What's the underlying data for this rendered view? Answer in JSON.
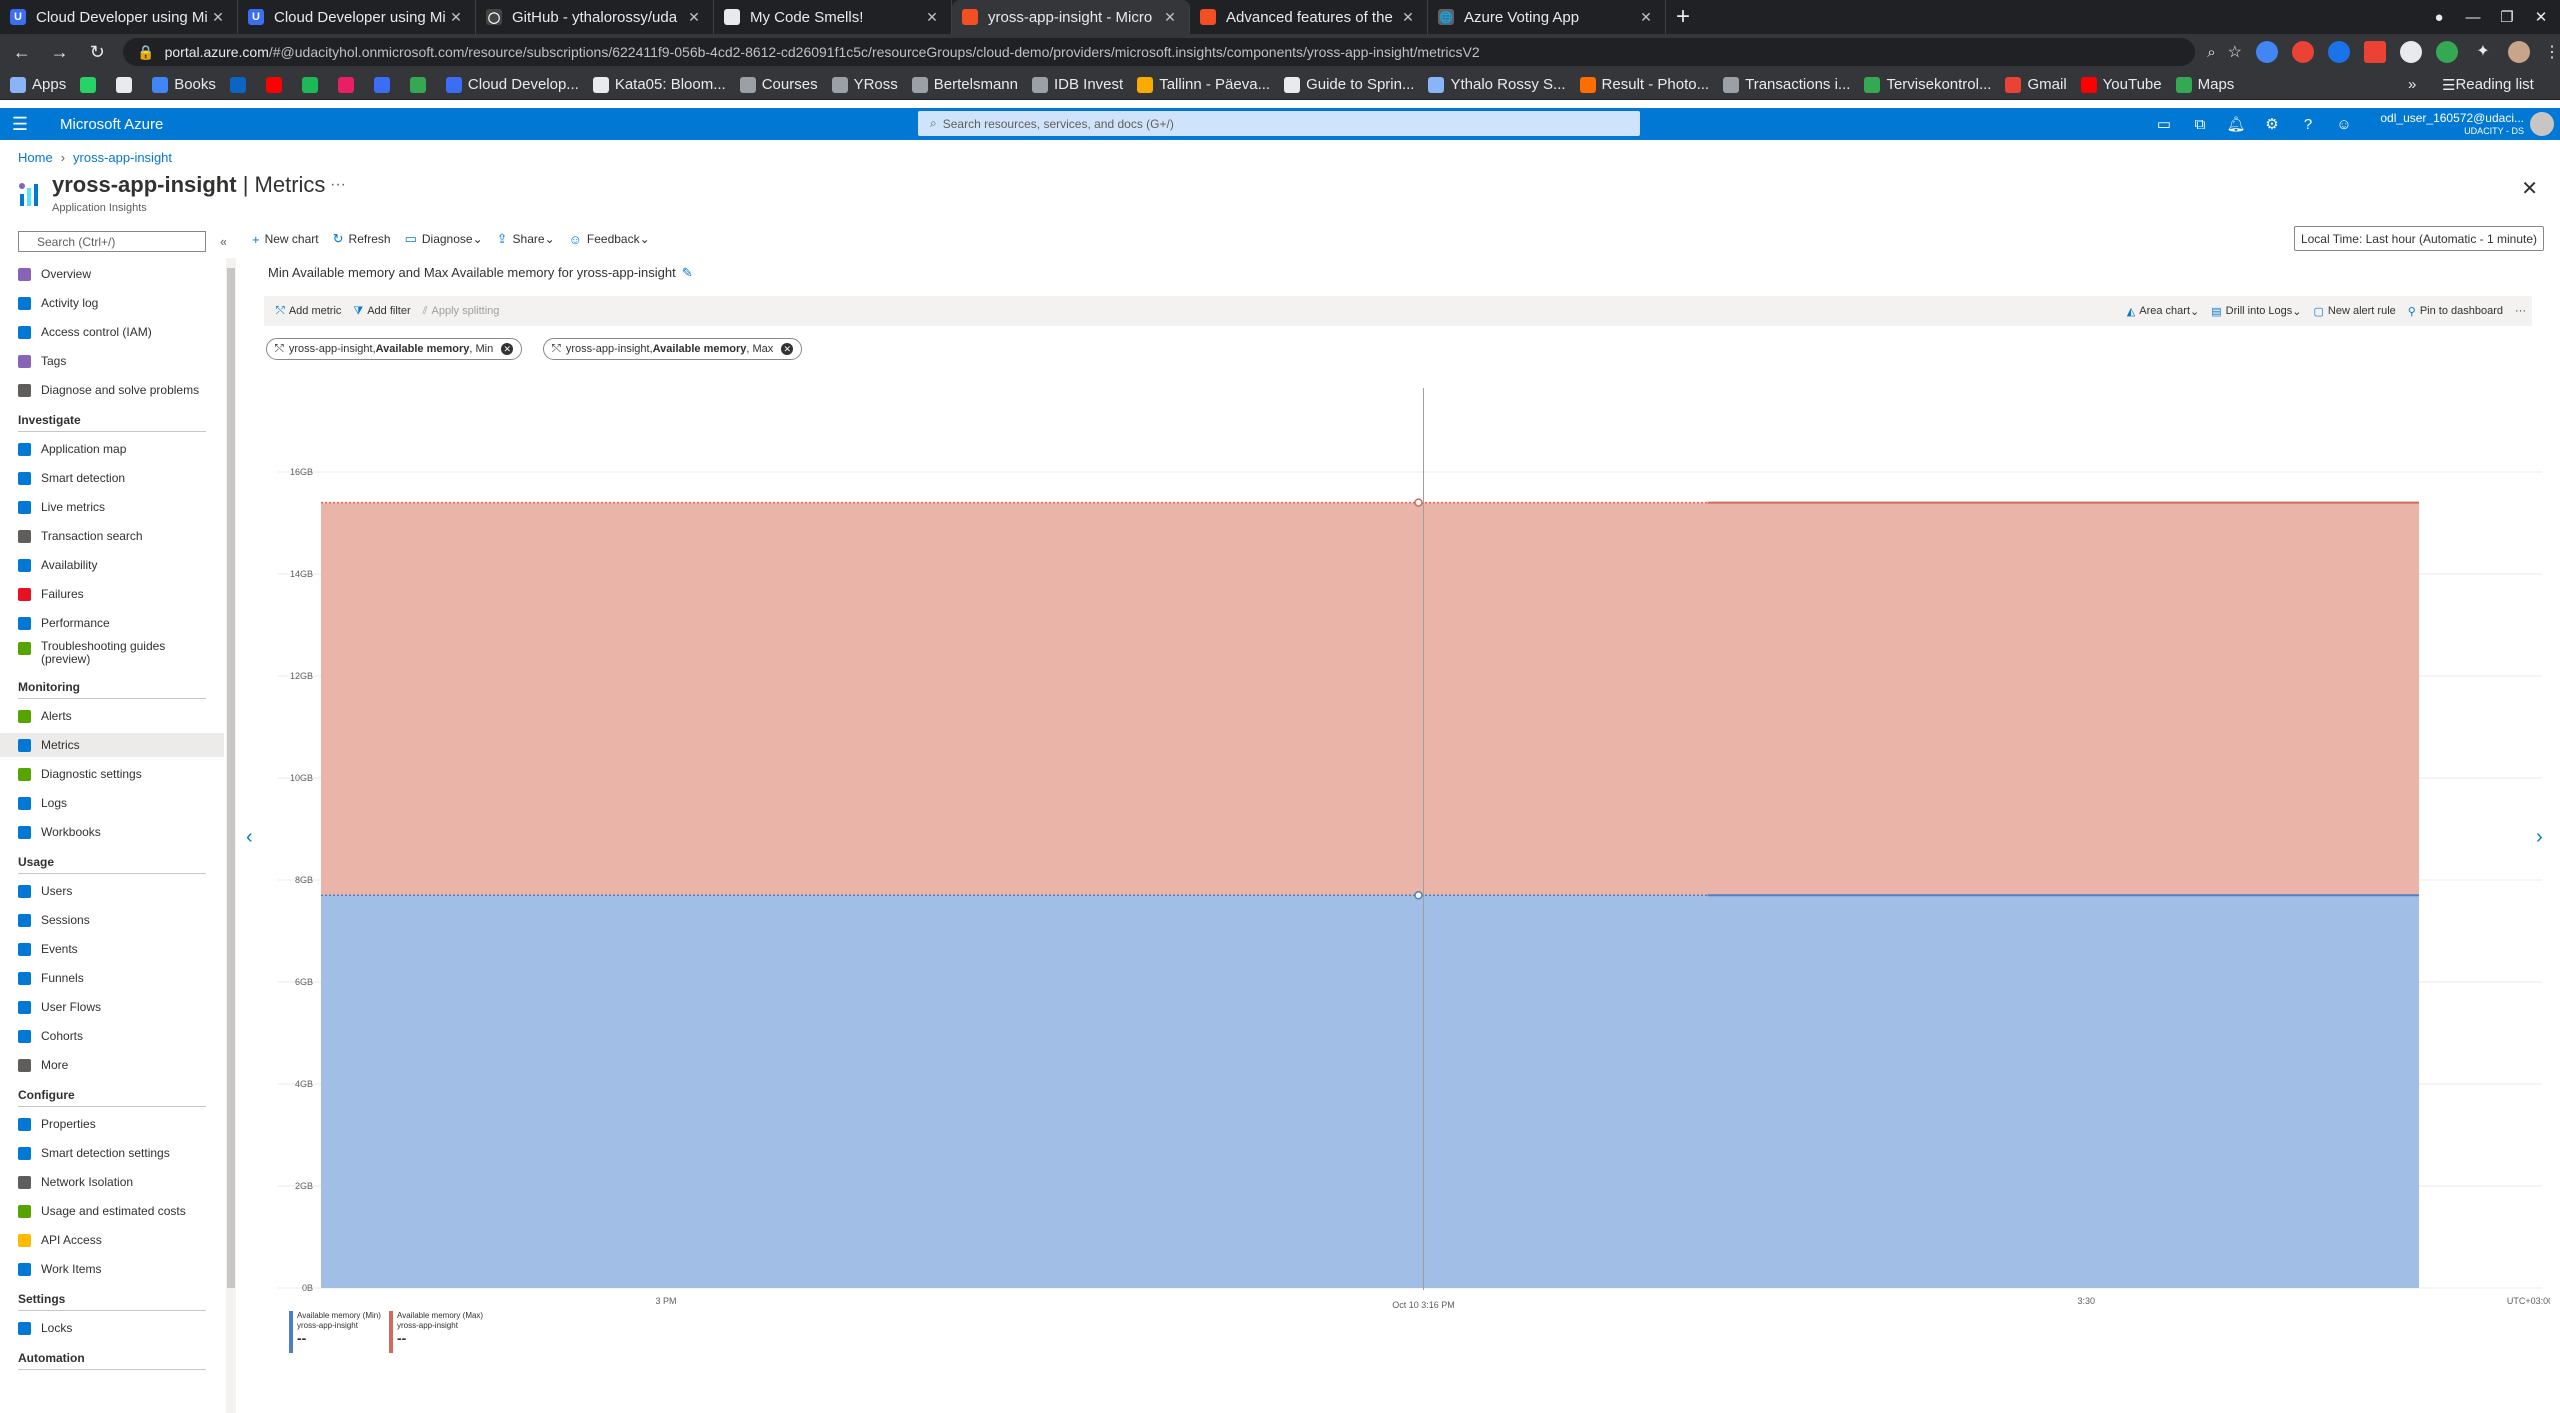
{
  "browser": {
    "tabs": [
      {
        "label": "Cloud Developer using Mi",
        "color": "#3b6ef5",
        "glyph": "U",
        "active": false
      },
      {
        "label": "Cloud Developer using Mi",
        "color": "#3b6ef5",
        "glyph": "U",
        "active": false
      },
      {
        "label": "GitHub - ythalorossy/uda",
        "color": "#444444",
        "glyph": "◯",
        "active": false
      },
      {
        "label": "My Code Smells!",
        "color": "#e8eaed",
        "glyph": "",
        "active": false
      },
      {
        "label": "yross-app-insight - Micro",
        "color": "#f25022",
        "glyph": "",
        "active": true
      },
      {
        "label": "Advanced features of the",
        "color": "#f25022",
        "glyph": "",
        "active": false
      },
      {
        "label": "Azure Voting App",
        "color": "#5f6368",
        "glyph": "🌐",
        "active": false
      }
    ],
    "url_host": "portal.azure.com",
    "url_path": "/#@udacityhol.onmicrosoft.com/resource/subscriptions/622411f9-056b-4cd2-8612-cd26091f1c5c/resourceGroups/cloud-demo/providers/microsoft.insights/components/yross-app-insight/metricsV2",
    "bookmarks": [
      {
        "label": "Apps",
        "color": "#8ab4f8"
      },
      {
        "label": "",
        "color": "#25d366"
      },
      {
        "label": "",
        "color": "#e8eaed"
      },
      {
        "label": "Books",
        "color": "#4285f4"
      },
      {
        "label": "",
        "color": "#0a66c2"
      },
      {
        "label": "",
        "color": "#ff0000"
      },
      {
        "label": "",
        "color": "#1db954"
      },
      {
        "label": "",
        "color": "#e91e63"
      },
      {
        "label": "",
        "color": "#3b6ef5"
      },
      {
        "label": "",
        "color": "#34a853"
      },
      {
        "label": "Cloud Develop...",
        "color": "#3b6ef5"
      },
      {
        "label": "Kata05: Bloom...",
        "color": "#e8eaed"
      },
      {
        "label": "Courses",
        "color": "#9aa0a6"
      },
      {
        "label": "YRoss",
        "color": "#9aa0a6"
      },
      {
        "label": "Bertelsmann",
        "color": "#9aa0a6"
      },
      {
        "label": "IDB Invest",
        "color": "#9aa0a6"
      },
      {
        "label": "Tallinn - Päeva...",
        "color": "#f9ab00"
      },
      {
        "label": "Guide to Sprin...",
        "color": "#e8eaed"
      },
      {
        "label": "Ythalo Rossy S...",
        "color": "#8ab4f8"
      },
      {
        "label": "Result - Photo...",
        "color": "#ff6d00"
      },
      {
        "label": "Transactions i...",
        "color": "#9aa0a6"
      },
      {
        "label": "Tervisekontrol...",
        "color": "#34a853"
      },
      {
        "label": "Gmail",
        "color": "#ea4335"
      },
      {
        "label": "YouTube",
        "color": "#ff0000"
      },
      {
        "label": "Maps",
        "color": "#34a853"
      }
    ],
    "bookmarks_overflow": "»",
    "reading_list": "Reading list"
  },
  "azure": {
    "brand": "Microsoft Azure",
    "search_placeholder": "Search resources, services, and docs (G+/)",
    "account_name": "odl_user_160572@udaci...",
    "account_sub": "UDACITY - DS"
  },
  "blade": {
    "breadcrumb": [
      "Home",
      "yross-app-insight"
    ],
    "resource_name": "yross-app-insight",
    "page_name": "Metrics",
    "title_sep": " | ",
    "resource_type": "Application Insights",
    "more": "···",
    "close": "✕"
  },
  "sidebar": {
    "search_placeholder": "Search (Ctrl+/)",
    "collapse": "«",
    "top_items": [
      {
        "label": "Overview",
        "icon": "bulb-icon",
        "color": "#8764b8"
      },
      {
        "label": "Activity log",
        "icon": "activity-log-icon",
        "color": "#0078d4"
      },
      {
        "label": "Access control (IAM)",
        "icon": "iam-icon",
        "color": "#0078d4"
      },
      {
        "label": "Tags",
        "icon": "tag-icon",
        "color": "#8764b8"
      },
      {
        "label": "Diagnose and solve problems",
        "icon": "wrench-icon",
        "color": "#605e5c"
      }
    ],
    "groups": [
      {
        "title": "Investigate",
        "items": [
          {
            "label": "Application map",
            "icon": "app-map-icon",
            "color": "#0078d4"
          },
          {
            "label": "Smart detection",
            "icon": "smart-detection-icon",
            "color": "#0078d4"
          },
          {
            "label": "Live metrics",
            "icon": "live-metrics-icon",
            "color": "#0078d4"
          },
          {
            "label": "Transaction search",
            "icon": "search-icon",
            "color": "#605e5c"
          },
          {
            "label": "Availability",
            "icon": "globe-icon",
            "color": "#0078d4"
          },
          {
            "label": "Failures",
            "icon": "failures-icon",
            "color": "#e81123"
          },
          {
            "label": "Performance",
            "icon": "performance-icon",
            "color": "#0078d4"
          },
          {
            "label": "Troubleshooting guides\n(preview)",
            "icon": "book-icon",
            "color": "#57a300"
          }
        ]
      },
      {
        "title": "Monitoring",
        "items": [
          {
            "label": "Alerts",
            "icon": "alerts-icon",
            "color": "#57a300"
          },
          {
            "label": "Metrics",
            "icon": "metrics-icon",
            "color": "#0078d4",
            "selected": true
          },
          {
            "label": "Diagnostic settings",
            "icon": "diagnostic-icon",
            "color": "#57a300"
          },
          {
            "label": "Logs",
            "icon": "logs-icon",
            "color": "#0078d4"
          },
          {
            "label": "Workbooks",
            "icon": "workbooks-icon",
            "color": "#0078d4"
          }
        ]
      },
      {
        "title": "Usage",
        "items": [
          {
            "label": "Users",
            "icon": "users-icon",
            "color": "#0078d4"
          },
          {
            "label": "Sessions",
            "icon": "sessions-icon",
            "color": "#0078d4"
          },
          {
            "label": "Events",
            "icon": "events-icon",
            "color": "#0078d4"
          },
          {
            "label": "Funnels",
            "icon": "funnels-icon",
            "color": "#0078d4"
          },
          {
            "label": "User Flows",
            "icon": "user-flows-icon",
            "color": "#0078d4"
          },
          {
            "label": "Cohorts",
            "icon": "cohorts-icon",
            "color": "#0078d4"
          },
          {
            "label": "More",
            "icon": "more-icon",
            "color": "#605e5c"
          }
        ]
      },
      {
        "title": "Configure",
        "items": [
          {
            "label": "Properties",
            "icon": "properties-icon",
            "color": "#0078d4"
          },
          {
            "label": "Smart detection settings",
            "icon": "smart-settings-icon",
            "color": "#0078d4"
          },
          {
            "label": "Network Isolation",
            "icon": "network-icon",
            "color": "#605e5c"
          },
          {
            "label": "Usage and estimated costs",
            "icon": "costs-icon",
            "color": "#57a300"
          },
          {
            "label": "API Access",
            "icon": "key-icon",
            "color": "#ffb900"
          },
          {
            "label": "Work Items",
            "icon": "work-items-icon",
            "color": "#0078d4"
          }
        ]
      },
      {
        "title": "Settings",
        "items": [
          {
            "label": "Locks",
            "icon": "lock-icon",
            "color": "#0078d4"
          }
        ]
      },
      {
        "title": "Automation",
        "items": []
      }
    ]
  },
  "commands": [
    {
      "label": "New chart",
      "icon": "plus-icon"
    },
    {
      "label": "Refresh",
      "icon": "refresh-icon"
    },
    {
      "label": "Diagnose",
      "icon": "diagnose-icon",
      "dropdown": true
    },
    {
      "label": "Share",
      "icon": "share-icon",
      "dropdown": true
    },
    {
      "label": "Feedback",
      "icon": "feedback-icon",
      "dropdown": true
    }
  ],
  "time_picker": "Local Time: Last hour (Automatic - 1 minute)",
  "chart_panel": {
    "title": "Min Available memory and Max Available memory for yross-app-insight",
    "toolbar_left": [
      {
        "label": "Add metric",
        "icon": "add-metric-icon",
        "disabled": false
      },
      {
        "label": "Add filter",
        "icon": "filter-icon",
        "disabled": false
      },
      {
        "label": "Apply splitting",
        "icon": "split-icon",
        "disabled": true
      }
    ],
    "toolbar_right": [
      {
        "label": "Area chart",
        "icon": "area-chart-icon",
        "dropdown": true
      },
      {
        "label": "Drill into Logs",
        "icon": "logs-icon",
        "dropdown": true
      },
      {
        "label": "New alert rule",
        "icon": "alert-rule-icon"
      },
      {
        "label": "Pin to dashboard",
        "icon": "pin-icon"
      }
    ],
    "toolbar_more": "···",
    "pills": [
      {
        "prefix": "yross-app-insight, ",
        "metric": "Available memory",
        "agg": ", Min"
      },
      {
        "prefix": "yross-app-insight, ",
        "metric": "Available memory",
        "agg": ", Max"
      }
    ]
  },
  "chart_data": {
    "type": "area",
    "ylim": [
      0,
      16
    ],
    "yticks": [
      "0B",
      "2GB",
      "4GB",
      "6GB",
      "8GB",
      "10GB",
      "12GB",
      "14GB",
      "16GB"
    ],
    "ytick_values": [
      0,
      2,
      4,
      6,
      8,
      10,
      12,
      14,
      16
    ],
    "x_labels": [
      "3 PM",
      "Oct 10 3:16 PM",
      "3:30"
    ],
    "x_label_minutes": [
      0,
      16,
      30
    ],
    "x_range_minutes": [
      -7.5,
      38
    ],
    "timezone": "UTC+03:00",
    "cursor_minute": 16,
    "grid": true,
    "series": [
      {
        "name": "Available memory (Min)",
        "resource": "yross-app-insight",
        "color": "#4c7fc9",
        "fill": "#a1bee6",
        "value": 7.7,
        "legend_value": "--"
      },
      {
        "name": "Available memory (Max)",
        "resource": "yross-app-insight",
        "color": "#d16a5a",
        "fill": "#ebb4a8",
        "value": 15.4,
        "legend_value": "--"
      }
    ]
  }
}
